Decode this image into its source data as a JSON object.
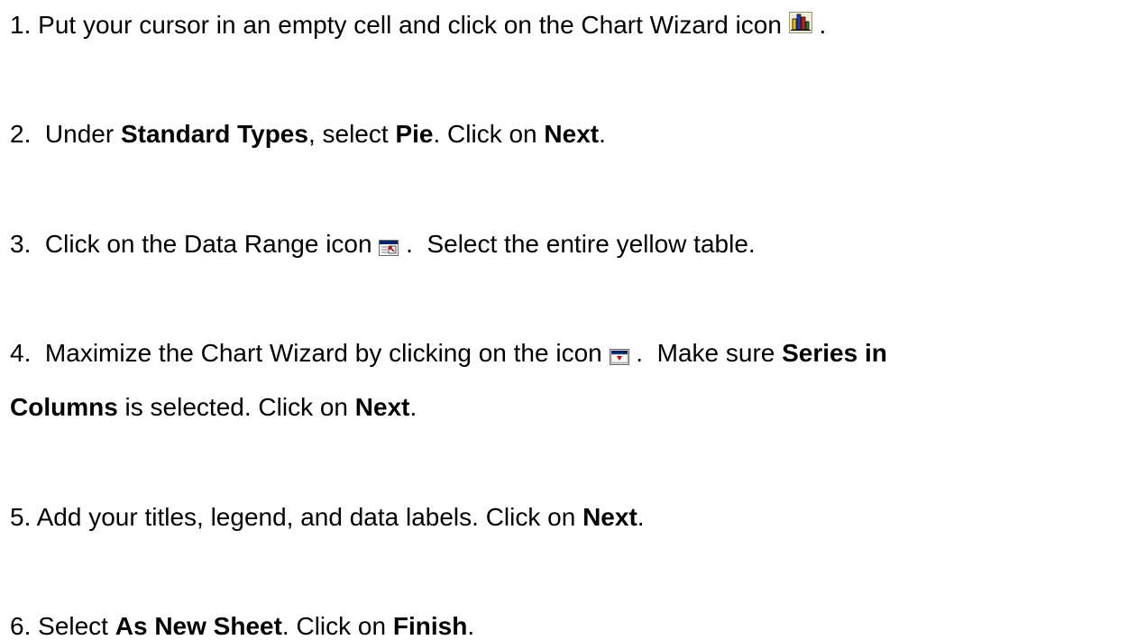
{
  "steps": [
    {
      "num": "1.",
      "text_a": " Put your cursor in an empty cell and click on the Chart Wizard icon ",
      "text_b": " ."
    },
    {
      "num": "2.",
      "text_a": "  Under ",
      "bold_a": "Standard Types",
      "text_b": ", select ",
      "bold_b": "Pie",
      "text_c": ". Click on ",
      "bold_c": "Next",
      "text_d": "."
    },
    {
      "num": "3.",
      "text_a": "  Click on the Data Range icon ",
      "text_b": " .  Select the entire yellow table."
    },
    {
      "num": "4.",
      "text_a": "  Maximize the Chart Wizard by clicking on the icon ",
      "text_b": " .  Make sure ",
      "bold_a": "Series in",
      "bold_b": "Columns",
      "text_c": " is selected. Click on ",
      "bold_c": "Next",
      "text_d": "."
    },
    {
      "num": "5.",
      "text_a": " Add your titles, legend, and data labels. Click on ",
      "bold_a": "Next",
      "text_b": "."
    },
    {
      "num": "6.",
      "text_a": " Select ",
      "bold_a": "As New Sheet",
      "text_b": ". Click on ",
      "bold_b": "Finish",
      "text_c": "."
    }
  ],
  "icons": {
    "chart_wizard": "chart-wizard-icon",
    "data_range": "data-range-icon",
    "maximize": "maximize-icon"
  }
}
